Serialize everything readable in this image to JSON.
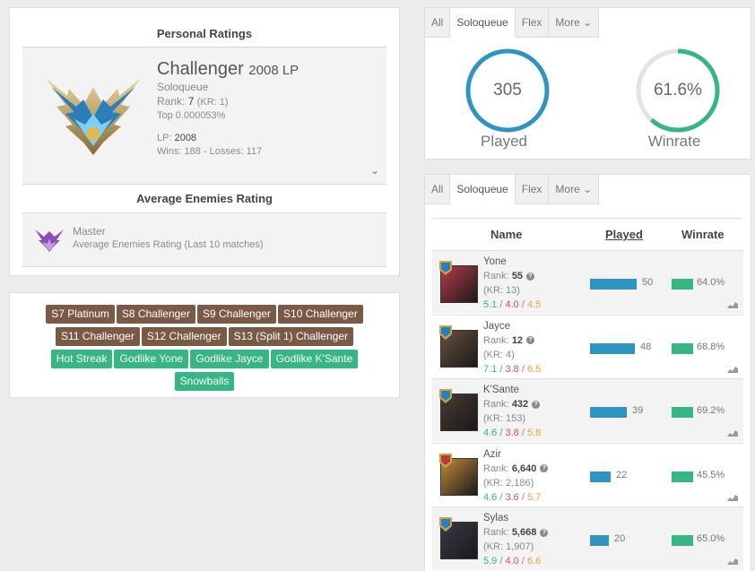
{
  "personal": {
    "title": "Personal Ratings",
    "tier": "Challenger",
    "lp_label": "2008 LP",
    "queue": "Soloqueue",
    "rank_label": "Rank:",
    "rank": "7",
    "rank_kr": "(KR: 1)",
    "top": "Top 0.000053%",
    "lp_line_label": "LP:",
    "lp_value": "2008",
    "wins_losses": "Wins: 188 - Losses: 117"
  },
  "enemies": {
    "title": "Average Enemies Rating",
    "tier": "Master",
    "subtitle": "Average Enemies Rating (Last 10 matches)"
  },
  "badges": [
    {
      "label": "S7 Platinum",
      "color": "#7b5a45"
    },
    {
      "label": "S8 Challenger",
      "color": "#7b5a45"
    },
    {
      "label": "S9 Challenger",
      "color": "#7b5a45"
    },
    {
      "label": "S10 Challenger",
      "color": "#7b5a45"
    },
    {
      "label": "S11 Challenger",
      "color": "#7b5a45"
    },
    {
      "label": "S12 Challenger",
      "color": "#7b5a45"
    },
    {
      "label": "S13 (Split 1) Challenger",
      "color": "#7b5a45"
    },
    {
      "label": "Hot Streak",
      "color": "#35b683"
    },
    {
      "label": "Godlike Yone",
      "color": "#35b683"
    },
    {
      "label": "Godlike Jayce",
      "color": "#35b683"
    },
    {
      "label": "Godlike K'Sante",
      "color": "#35b683"
    },
    {
      "label": "Snowballs",
      "color": "#35b683"
    }
  ],
  "tabs": [
    "All",
    "Soloqueue",
    "Flex",
    "More ⌄"
  ],
  "stats": {
    "played_value": "305",
    "played_label": "Played",
    "winrate_value": "61.6%",
    "winrate_label": "Winrate",
    "winrate_fraction": 0.616,
    "played_color": "#2f95c0",
    "winrate_color": "#35b683"
  },
  "table": {
    "headers": {
      "name": "Name",
      "played": "Played",
      "winrate": "Winrate"
    },
    "rows": [
      {
        "name": "Yone",
        "rank_label": "Rank:",
        "rank": "55",
        "kr": "(KR: 13)",
        "k": "5.1",
        "d": "4.0",
        "a": "4.5",
        "played": 50,
        "played_text": "50",
        "winrate": "64.0%"
      },
      {
        "name": "Jayce",
        "rank_label": "Rank:",
        "rank": "12",
        "kr": "(KR: 4)",
        "k": "7.1",
        "d": "3.8",
        "a": "6.5",
        "played": 48,
        "played_text": "48",
        "winrate": "68.8%"
      },
      {
        "name": "K'Sante",
        "rank_label": "Rank:",
        "rank": "432",
        "kr": "(KR: 153)",
        "k": "4.6",
        "d": "3.8",
        "a": "5.8",
        "played": 39,
        "played_text": "39",
        "winrate": "69.2%"
      },
      {
        "name": "Azir",
        "rank_label": "Rank:",
        "rank": "6,640",
        "kr": "(KR: 2,186)",
        "k": "4.6",
        "d": "3.6",
        "a": "5.7",
        "played": 22,
        "played_text": "22",
        "winrate": "45.5%"
      },
      {
        "name": "Sylas",
        "rank_label": "Rank:",
        "rank": "5,668",
        "kr": "(KR: 1,907)",
        "k": "5.9",
        "d": "4.0",
        "a": "6.6",
        "played": 20,
        "played_text": "20",
        "winrate": "65.0%"
      }
    ]
  }
}
